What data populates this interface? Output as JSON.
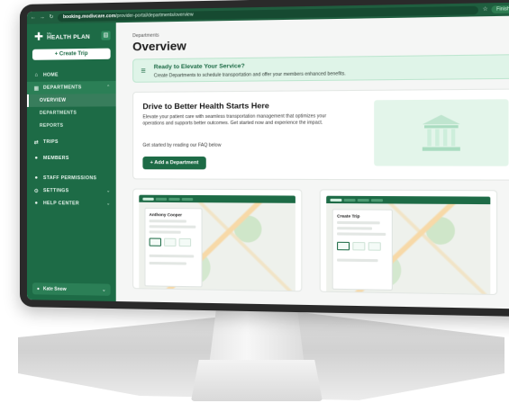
{
  "browser": {
    "url_host": "booking.modivcare.com",
    "url_path": "/provider-portal/departments/overview",
    "finish_update_label": "Finish update"
  },
  "sidebar": {
    "logo_small": "My",
    "logo_title": "HEALTH PLAN",
    "create_trip_label": "+ Create Trip",
    "items": [
      {
        "label": "HOME"
      },
      {
        "label": "DEPARTMENTS"
      },
      {
        "label": "TRIPS"
      },
      {
        "label": "MEMBERS"
      },
      {
        "label": "STAFF PERMISSIONS"
      },
      {
        "label": "SETTINGS"
      },
      {
        "label": "HELP CENTER"
      }
    ],
    "sub_items": [
      {
        "label": "OVERVIEW"
      },
      {
        "label": "DEPARTMENTS"
      },
      {
        "label": "REPORTS"
      }
    ],
    "user_name": "Kate Snow"
  },
  "main": {
    "breadcrumb": "Departments",
    "title": "Overview",
    "banner": {
      "title": "Ready to Elevate Your Service?",
      "text": "Create Departments to schedule transportation and offer your members enhanced benefits."
    },
    "hero": {
      "title": "Drive to Better Health Starts Here",
      "text": "Elevate your patient care with seamless transportation management that optimizes your operations and supports better outcomes. Get started now and experience the impact.",
      "faq": "Get started by reading our FAQ below",
      "button_label": "+ Add a Department"
    },
    "previews": [
      {
        "title": "Anthony Cooper"
      },
      {
        "title": "Create Trip"
      }
    ]
  },
  "colors": {
    "brand": "#1d6b46",
    "banner_bg": "#dff4e8"
  }
}
